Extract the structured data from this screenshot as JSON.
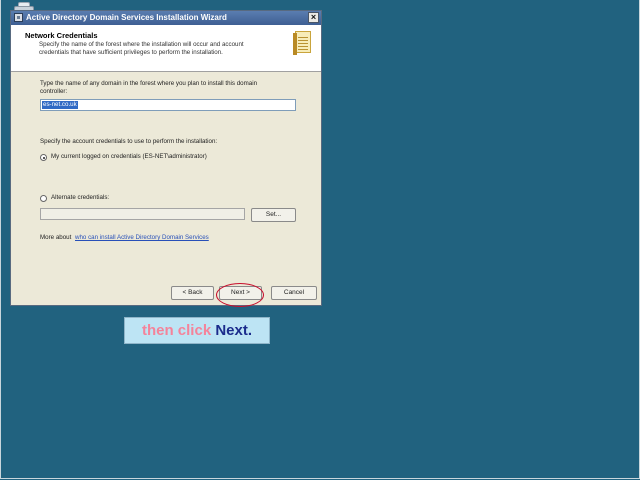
{
  "window": {
    "title": "Active Directory Domain Services Installation Wizard",
    "close_glyph": "×"
  },
  "header": {
    "title": "Network Credentials",
    "description": "Specify the name of the forest where the installation will occur and account credentials that have sufficient privileges to perform the installation.",
    "icon": "wizard-book-icon"
  },
  "domain": {
    "prompt": "Type the name of any domain in the forest where you plan to install this domain controller:",
    "value": "es-net.co.uk"
  },
  "credentials": {
    "prompt": "Specify the account credentials to use to perform the installation:",
    "current_option": "My current logged on credentials (ES-NET\\administrator)",
    "alternate_option": "Alternate credentials:",
    "set_button": "Set..."
  },
  "more_info": {
    "prefix": "More about",
    "link": "who can install Active Directory Domain Services"
  },
  "buttons": {
    "back": "< Back",
    "next": "Next >",
    "cancel": "Cancel"
  },
  "caption": {
    "part1": "then click",
    "part2": "Next."
  },
  "colors": {
    "desktop": "#21627f",
    "highlight_ring": "#c8102e",
    "caption_bg": "#bde4f4"
  }
}
